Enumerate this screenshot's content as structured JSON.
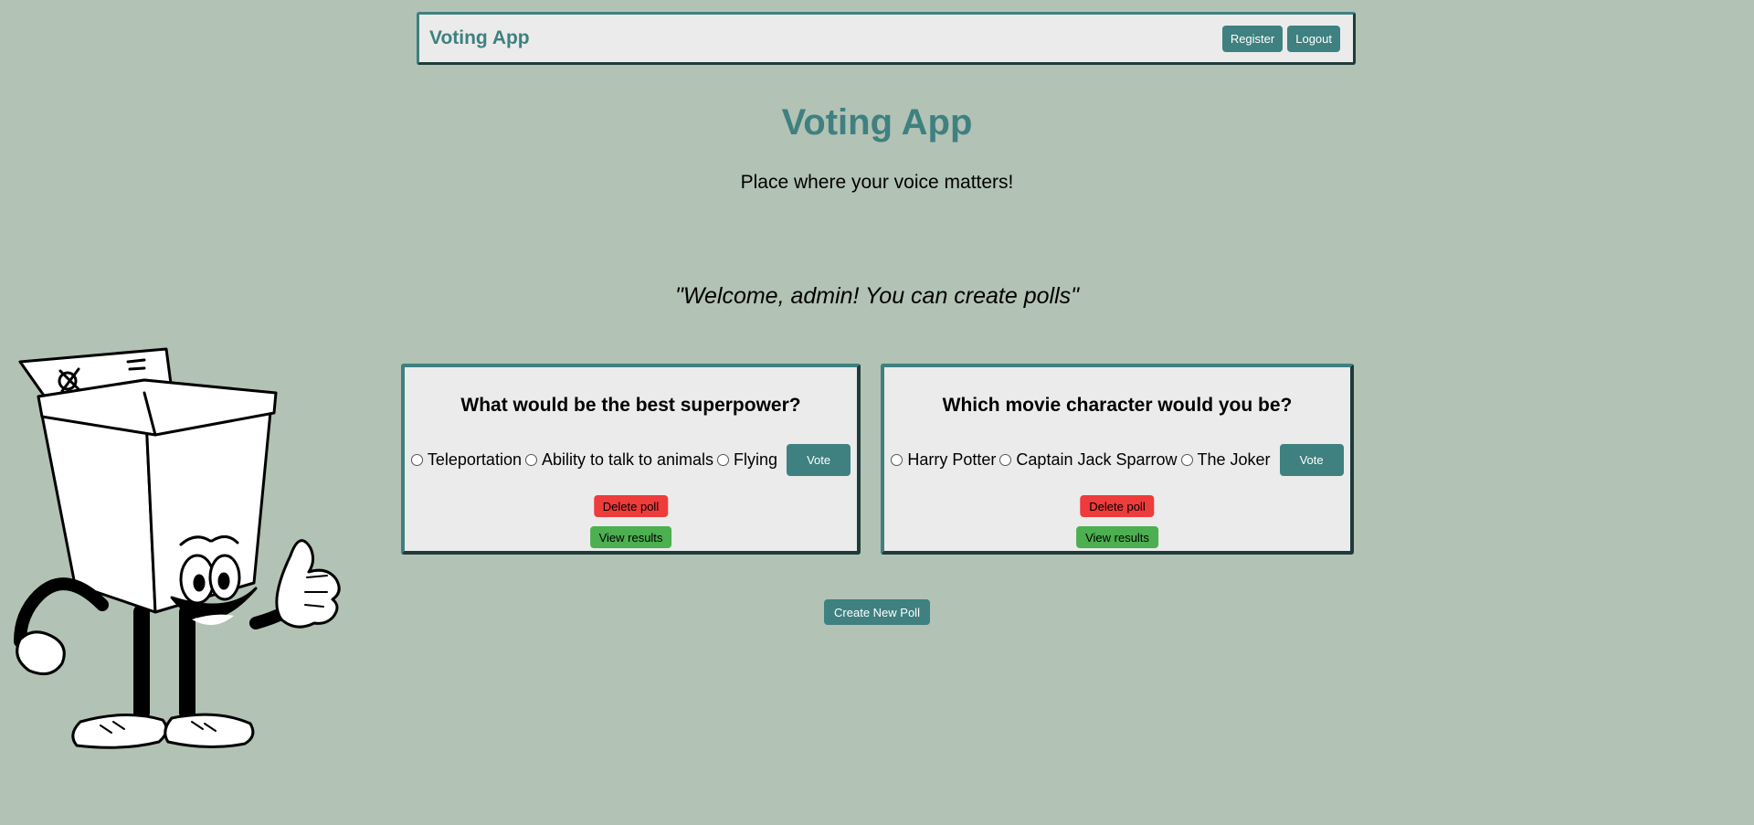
{
  "navbar": {
    "brand": "Voting App",
    "register_label": "Register",
    "logout_label": "Logout"
  },
  "hero": {
    "title": "Voting App",
    "tagline": "Place where your voice matters!"
  },
  "welcome_message": "\"Welcome, admin! You can create polls\"",
  "polls": [
    {
      "question": "What would be the best superpower?",
      "options": [
        "Teleportation",
        "Ability to talk to animals",
        "Flying"
      ],
      "vote_label": "Vote",
      "delete_label": "Delete poll",
      "results_label": "View results"
    },
    {
      "question": "Which movie character would you be?",
      "options": [
        "Harry Potter",
        "Captain Jack Sparrow",
        "The Joker"
      ],
      "vote_label": "Vote",
      "delete_label": "Delete poll",
      "results_label": "View results"
    }
  ],
  "create_poll_label": "Create New Poll",
  "colors": {
    "background": "#b2c2b4",
    "accent": "#3f8080",
    "danger": "#ee3b3b",
    "success": "#4caf50",
    "card": "#ebebeb"
  },
  "icons": {
    "mascot": "ballot-box-mascot-illustration"
  }
}
